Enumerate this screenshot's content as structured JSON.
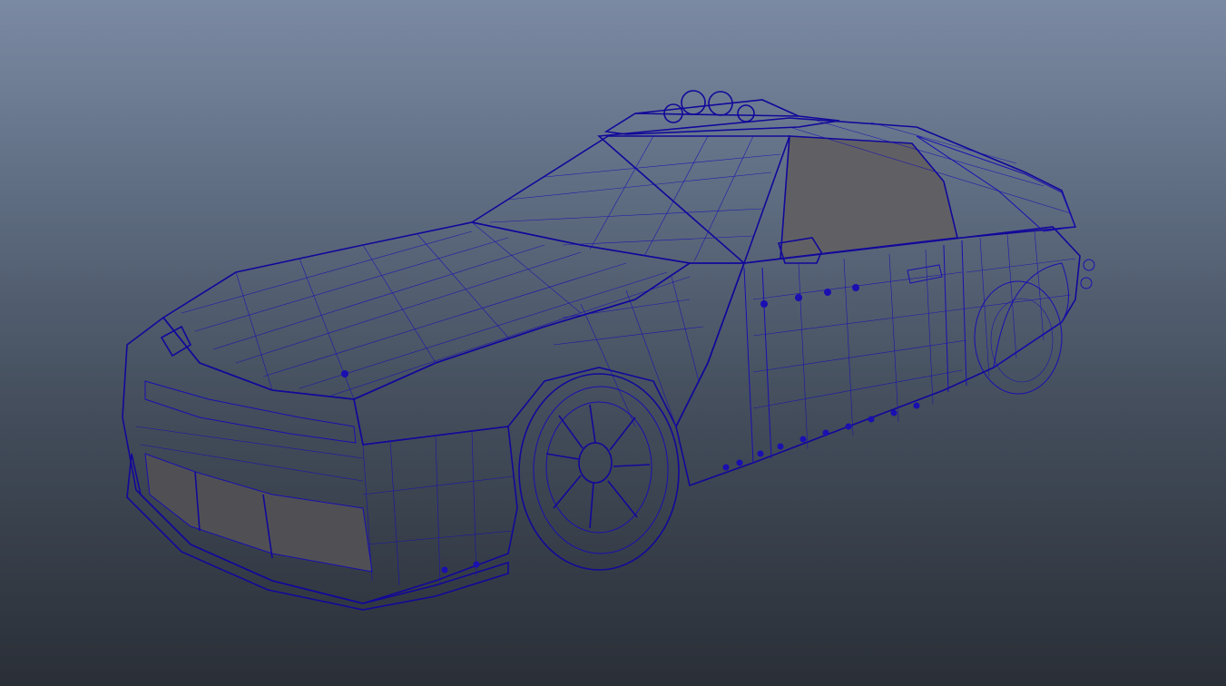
{
  "viewport": {
    "background_top": "#7b8aa3",
    "background_bottom": "#2a2f37",
    "wire_color": "#1a0fb0",
    "shade_color": "#6e6e72",
    "display_mode": "wireframe-on-shaded"
  },
  "model": {
    "object": "armored-car-mesh"
  }
}
